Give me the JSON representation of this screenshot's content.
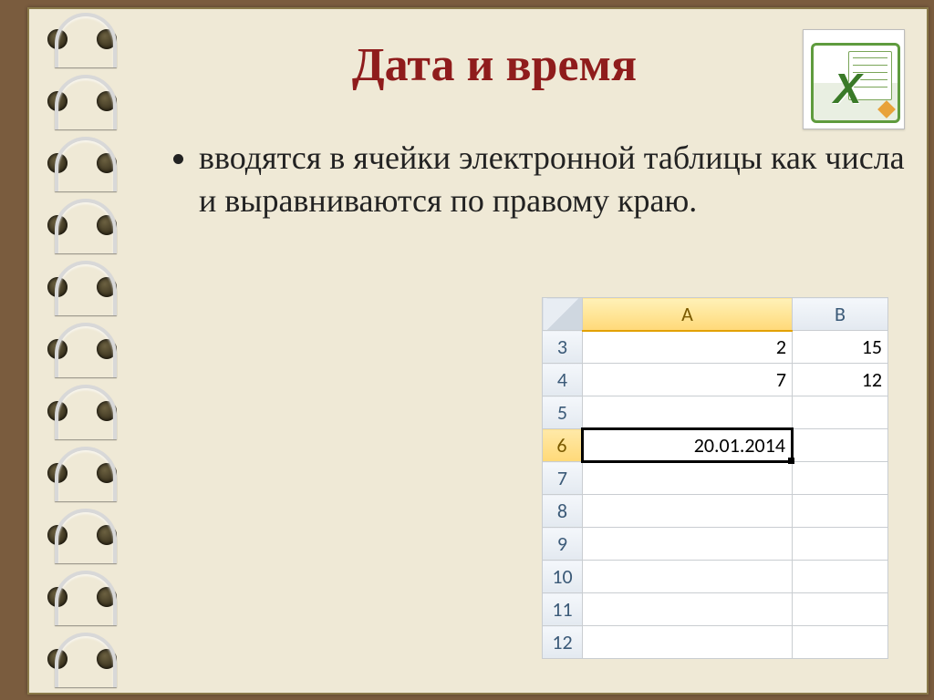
{
  "title": "Дата и время",
  "bullet": "вводятся в ячейки электронной таблицы как числа и выравниваются по правому краю.",
  "sheet": {
    "colA": "A",
    "colB": "B",
    "rows": {
      "r3": "3",
      "r4": "4",
      "r5": "5",
      "r6": "6",
      "r7": "7",
      "r8": "8",
      "r9": "9",
      "r10": "10",
      "r11": "11",
      "r12": "12"
    },
    "A3": "2",
    "B3": "15",
    "A4": "7",
    "B4": "12",
    "A6": "20.01.2014"
  }
}
